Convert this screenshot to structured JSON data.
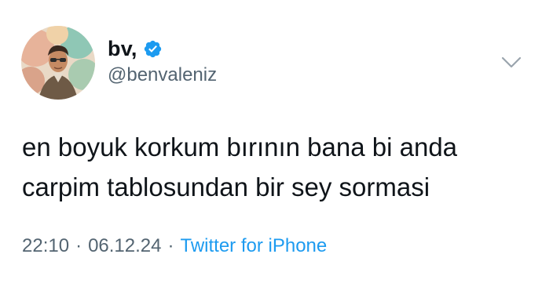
{
  "author": {
    "display_name": "bv,",
    "handle": "@benvaleniz",
    "verified_color": "#1d9bf0",
    "icons": {
      "verified": "verified-badge-icon",
      "menu": "chevron-down-icon"
    }
  },
  "tweet": {
    "lines": [
      "en boyuk korkum bırının bana bi anda",
      "carpim tablosundan bir sey sormasi"
    ]
  },
  "meta": {
    "time": "22:10",
    "separator": "·",
    "date": "06.12.24",
    "source": "Twitter for iPhone"
  },
  "colors": {
    "text": "#0f1419",
    "secondary": "#536471",
    "accent": "#1d9bf0"
  }
}
